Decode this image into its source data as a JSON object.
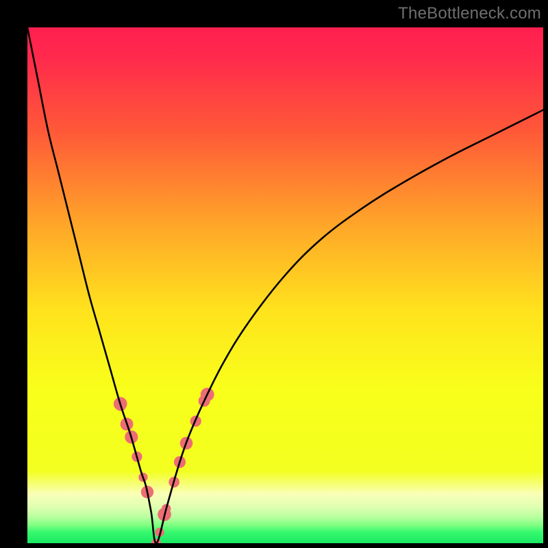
{
  "watermark": "TheBottleneck.com",
  "chart_data": {
    "type": "line",
    "title": "",
    "xlabel": "",
    "ylabel": "",
    "x_range": [
      0,
      100
    ],
    "y_range": [
      0,
      100
    ],
    "notch_x": 25,
    "curve_left": {
      "x": [
        0,
        2,
        4,
        6,
        8,
        10,
        12,
        14,
        16,
        18,
        20,
        22,
        23,
        24,
        25
      ],
      "y": [
        100,
        90,
        80,
        72,
        64,
        56,
        48,
        41,
        34,
        27,
        21,
        14,
        11,
        6,
        0
      ]
    },
    "curve_right": {
      "x": [
        25,
        27,
        29,
        31,
        34,
        38,
        43,
        50,
        57,
        65,
        73,
        82,
        90,
        96,
        100
      ],
      "y": [
        0,
        7,
        14,
        20,
        27,
        35,
        43,
        52,
        59,
        65,
        70,
        75,
        79,
        82,
        84
      ]
    },
    "dot_regions": [
      {
        "x_min": 18,
        "x_max": 24,
        "y_min": 9,
        "y_max": 35
      },
      {
        "x_min": 24,
        "x_max": 28,
        "y_min": 0,
        "y_max": 7
      },
      {
        "x_min": 28,
        "x_max": 35,
        "y_min": 12,
        "y_max": 35
      }
    ],
    "gradient_stops": [
      {
        "pos": 0.0,
        "color": "#ff1f4f"
      },
      {
        "pos": 0.06,
        "color": "#ff2a4c"
      },
      {
        "pos": 0.2,
        "color": "#ff5838"
      },
      {
        "pos": 0.38,
        "color": "#ffa529"
      },
      {
        "pos": 0.55,
        "color": "#ffe31d"
      },
      {
        "pos": 0.7,
        "color": "#f8ff1a"
      },
      {
        "pos": 0.86,
        "color": "#f3ff20"
      },
      {
        "pos": 0.905,
        "color": "#f9ffb8"
      },
      {
        "pos": 0.93,
        "color": "#dfffb0"
      },
      {
        "pos": 0.95,
        "color": "#b6ff9e"
      },
      {
        "pos": 0.965,
        "color": "#7fff82"
      },
      {
        "pos": 0.978,
        "color": "#38f96e"
      },
      {
        "pos": 1.0,
        "color": "#19e864"
      }
    ],
    "dot_color": "#ed6d74",
    "curve_color": "#000000",
    "curve_width": 2.6
  }
}
